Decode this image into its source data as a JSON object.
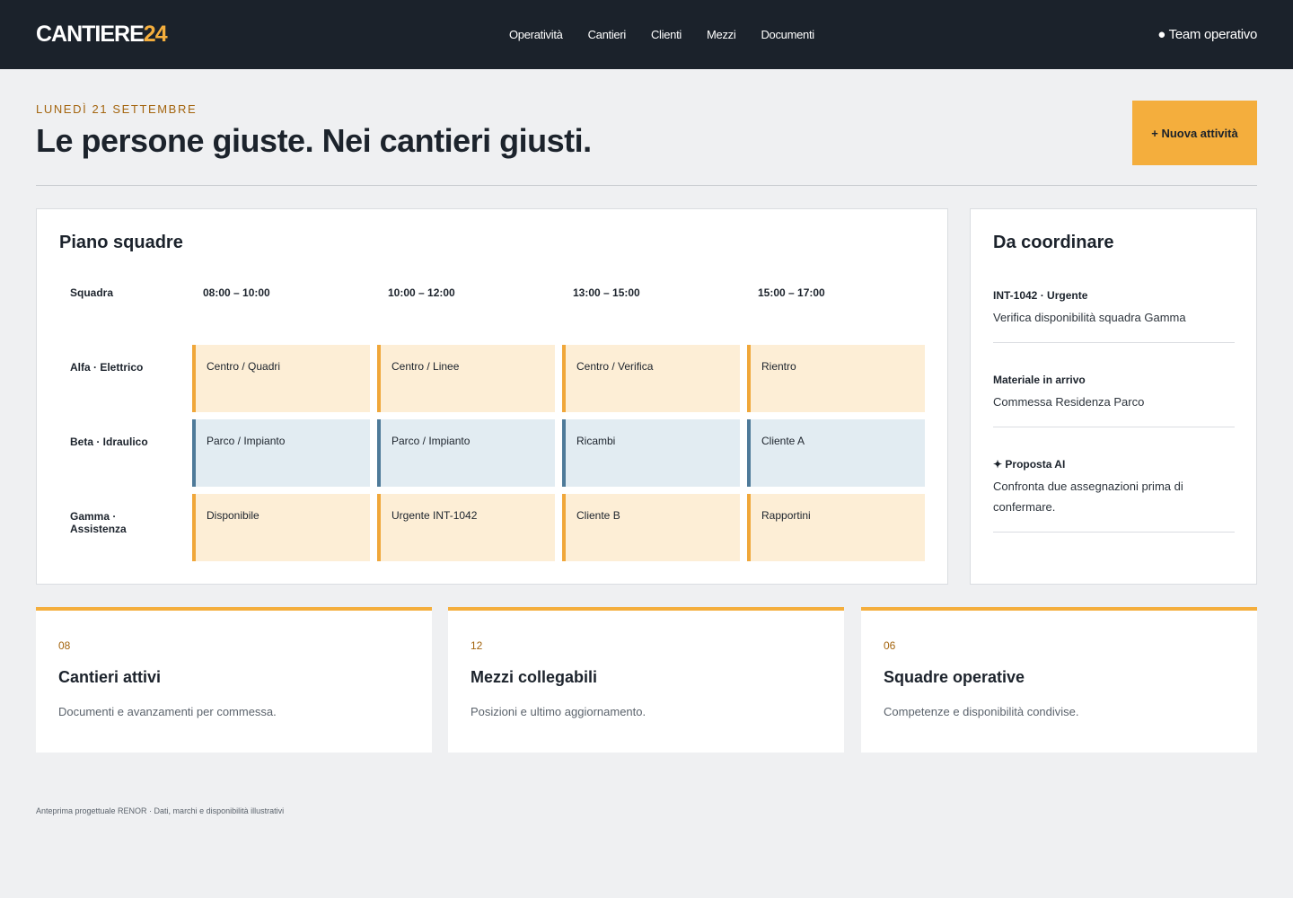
{
  "header": {
    "logo_main": "CANTIERE",
    "logo_accent": "24",
    "nav": [
      "Operatività",
      "Cantieri",
      "Clienti",
      "Mezzi",
      "Documenti"
    ],
    "team": "● Team operativo"
  },
  "hero": {
    "date": "LUNEDÌ 21 SETTEMBRE",
    "headline": "Le persone giuste. Nei cantieri giusti.",
    "new_button": "+ Nuova attività"
  },
  "plan": {
    "title": "Piano squadre",
    "columns": [
      "Squadra",
      "08:00 – 10:00",
      "10:00 – 12:00",
      "13:00 – 15:00",
      "15:00 – 17:00"
    ],
    "rows": [
      {
        "team": "Alfa · Elettrico",
        "cells": [
          "Centro / Quadri",
          "Centro / Linee",
          "Centro / Verifica",
          "Rientro"
        ]
      },
      {
        "team": "Beta · Idraulico",
        "cells": [
          "Parco / Impianto",
          "Parco / Impianto",
          "Ricambi",
          "Cliente A"
        ]
      },
      {
        "team": "Gamma · Assistenza",
        "cells": [
          "Disponibile",
          "Urgente INT-1042",
          "Cliente B",
          "Rapportini"
        ]
      }
    ]
  },
  "coord": {
    "title": "Da coordinare",
    "items": [
      {
        "title": "INT-1042 · Urgente",
        "desc": "Verifica disponibilità squadra Gamma"
      },
      {
        "title": "Materiale in arrivo",
        "desc": "Commessa Residenza Parco"
      },
      {
        "title": "✦ Proposta AI",
        "desc": "Confronta due assegnazioni prima di confermare."
      }
    ]
  },
  "cards": [
    {
      "num": "08",
      "title": "Cantieri attivi",
      "desc": "Documenti e avanzamenti per commessa."
    },
    {
      "num": "12",
      "title": "Mezzi collegabili",
      "desc": "Posizioni e ultimo aggiornamento."
    },
    {
      "num": "06",
      "title": "Squadre operative",
      "desc": "Competenze e disponibilità condivise."
    }
  ],
  "footer": "Anteprima progettuale RENOR · Dati, marchi e disponibilità illustrativi",
  "colors": {
    "accent": "#f4ae3d",
    "header_bg": "#1b222b",
    "cell_orange": "#fdeed6",
    "cell_blue": "#e2ecf2"
  }
}
